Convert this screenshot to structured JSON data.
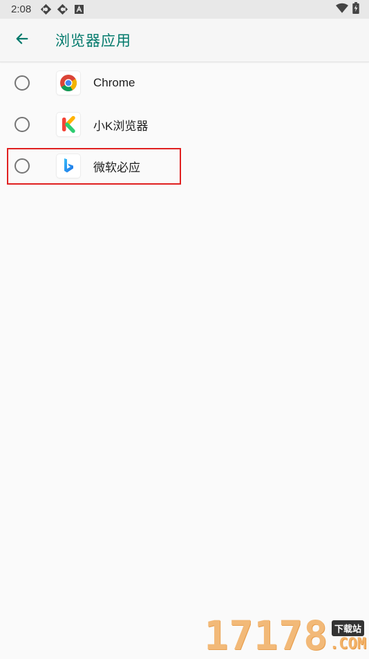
{
  "status_bar": {
    "time": "2:08",
    "icons_left": [
      "sync-icon",
      "sync-icon",
      "text-a-icon"
    ],
    "icons_right": [
      "wifi-icon",
      "battery-charging-icon"
    ]
  },
  "app_bar": {
    "title": "浏览器应用",
    "back_icon": "arrow-left-icon",
    "accent_color": "#00796b"
  },
  "apps": [
    {
      "label": "Chrome",
      "icon": "chrome-icon",
      "selected": false
    },
    {
      "label": "小K浏览器",
      "icon": "xiaok-browser-icon",
      "selected": false
    },
    {
      "label": "微软必应",
      "icon": "bing-icon",
      "selected": false
    }
  ],
  "highlight": {
    "target": "微软必应",
    "color": "#e02020"
  },
  "watermark": {
    "digits": "17178",
    "tag": "下载站",
    "suffix": ".COM"
  }
}
